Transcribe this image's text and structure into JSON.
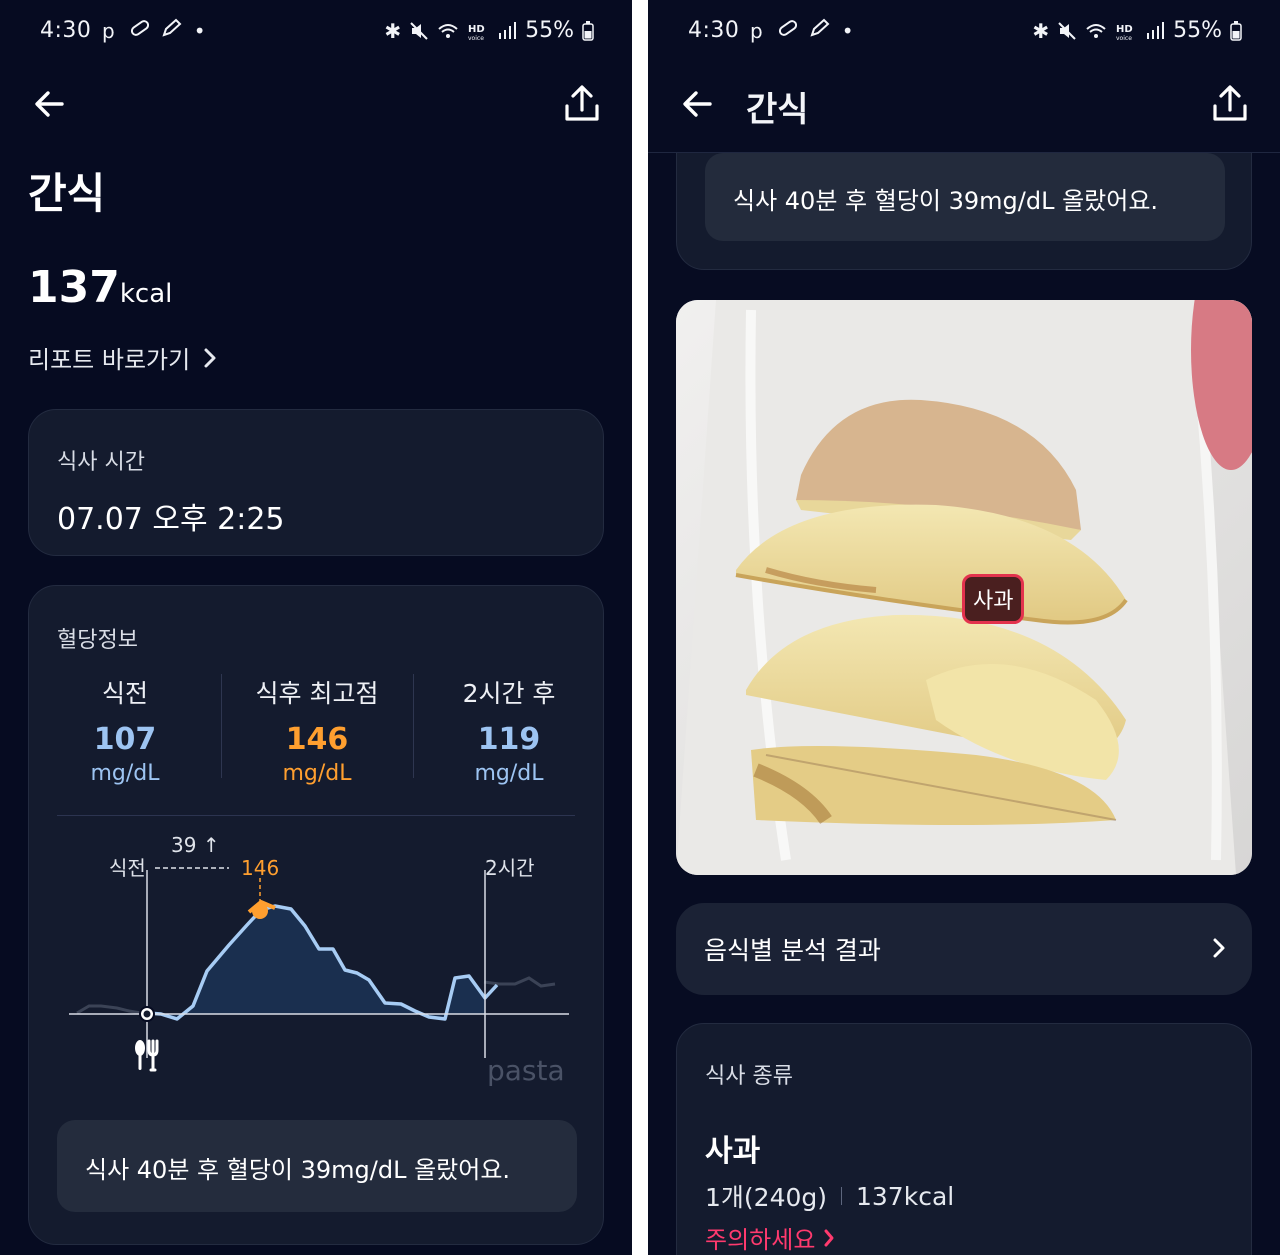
{
  "status_bar": {
    "time": "4:30",
    "battery": "55%",
    "left_icons": [
      "p-icon",
      "pill-icon",
      "pencil-icon",
      "dot-icon"
    ],
    "right_icons": [
      "bluetooth-icon",
      "mute-icon",
      "wifi-icon",
      "hd-voice-icon",
      "signal-icon",
      "battery-icon"
    ]
  },
  "left": {
    "meal_title": "간식",
    "kcal_value": "137",
    "kcal_unit": "kcal",
    "report_link": "리포트 바로가기",
    "meal_time": {
      "label": "식사 시간",
      "value": "07.07 오후 2:25"
    },
    "glucose": {
      "label": "혈당정보",
      "stats": [
        {
          "label": "식전",
          "value": "107",
          "unit": "mg/dL"
        },
        {
          "label": "식후 최고점",
          "value": "146",
          "unit": "mg/dL"
        },
        {
          "label": "2시간 후",
          "value": "119",
          "unit": "mg/dL"
        }
      ],
      "chart": {
        "rise_label": "39",
        "rise_arrow": "↑",
        "before_label": "식전",
        "peak_label": "146",
        "two_hour_label": "2시간",
        "watermark": "pasta"
      },
      "message": "식사 40분 후 혈당이 39mg/dL 올랐어요."
    }
  },
  "right": {
    "header_title": "간식",
    "message": "식사 40분 후 혈당이 39mg/dL 올랐어요.",
    "food_tag": "사과",
    "analysis_button": "음식별 분석 결과",
    "meal_type": {
      "label": "식사 종류",
      "food_name": "사과",
      "portion": "1개(240g)",
      "kcal": "137kcal",
      "caution": "주의하세요"
    }
  },
  "colors": {
    "background": "#060b21",
    "card": "#141b2e",
    "before_blue": "#9dc4f2",
    "peak_orange": "#ff9f2f",
    "caution_pink": "#ff3a6e"
  }
}
